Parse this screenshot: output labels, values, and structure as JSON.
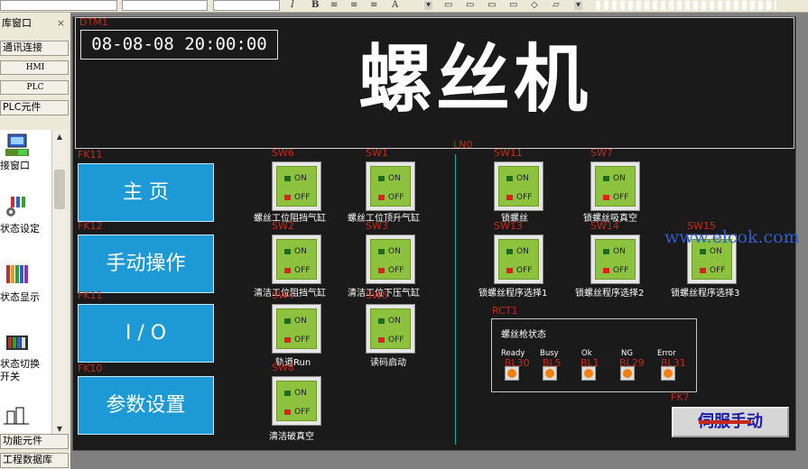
{
  "toolbar": {
    "bold_label": "B",
    "italic_label": "I"
  },
  "left_panel": {
    "header": "库窗口",
    "close_icon": "×",
    "tabs": [
      "通讯连接",
      "HMI",
      "PLC",
      "PLC元件"
    ],
    "library": [
      {
        "label": "接窗口",
        "icon": "link-window-icon"
      },
      {
        "label": "状态设定",
        "icon": "state-set-icon"
      },
      {
        "label": "状态显示",
        "icon": "state-display-icon"
      },
      {
        "label": "状态切换开关",
        "icon": "state-switch-icon"
      }
    ],
    "bottom_tabs": [
      "功能元件",
      "工程数据库"
    ]
  },
  "screen": {
    "clock": "08-08-08 20:00:00",
    "title": "螺丝机",
    "tags": {
      "dtm": "DTM1",
      "line": "LN0",
      "fk1": "FK11",
      "fk2": "FK12",
      "fk3": "FK11",
      "fk4": "FK10",
      "rct": "RCT1",
      "fk7": "FK7"
    },
    "nav": [
      "主  页",
      "手动操作",
      "I / O",
      "参数设置"
    ],
    "switch_on": "ON",
    "switch_off": "OFF",
    "switches": [
      {
        "tag": "SW6",
        "label": "螺丝工位阻挡气缸"
      },
      {
        "tag": "SW1",
        "label": "螺丝工位顶升气缸"
      },
      {
        "tag": "SW11",
        "label": "锁螺丝"
      },
      {
        "tag": "SW7",
        "label": "锁螺丝吸真空"
      },
      {
        "tag": "SW2",
        "label": "清洁工位阻挡气缸"
      },
      {
        "tag": "SW3",
        "label": "清洁工位下压气缸"
      },
      {
        "tag": "SW13",
        "label": "锁螺丝程序选择1"
      },
      {
        "tag": "SW14",
        "label": "锁螺丝程序选择2"
      },
      {
        "tag": "SW15",
        "label": "锁螺丝程序选择3"
      },
      {
        "tag": "SW4",
        "label": "轨道Run"
      },
      {
        "tag": "SW5",
        "label": "读码启动"
      },
      {
        "tag": "SW8",
        "label": "清洁破真空"
      }
    ],
    "status": {
      "title": "螺丝枪状态",
      "items": [
        {
          "label": "Ready",
          "tag": "BL30"
        },
        {
          "label": "Busy",
          "tag": "BL5"
        },
        {
          "label": "Ok",
          "tag": "BL1"
        },
        {
          "label": "NG",
          "tag": "BL29"
        },
        {
          "label": "Error",
          "tag": "BL31"
        }
      ]
    },
    "servo_button": "伺服手动",
    "watermark": "www.elcok.com"
  },
  "colors": {
    "nav_blue": "#1d9ad6",
    "switch_green": "#8dc23e",
    "tag_red": "#c32a18",
    "status_orange": "#f77f0b"
  }
}
